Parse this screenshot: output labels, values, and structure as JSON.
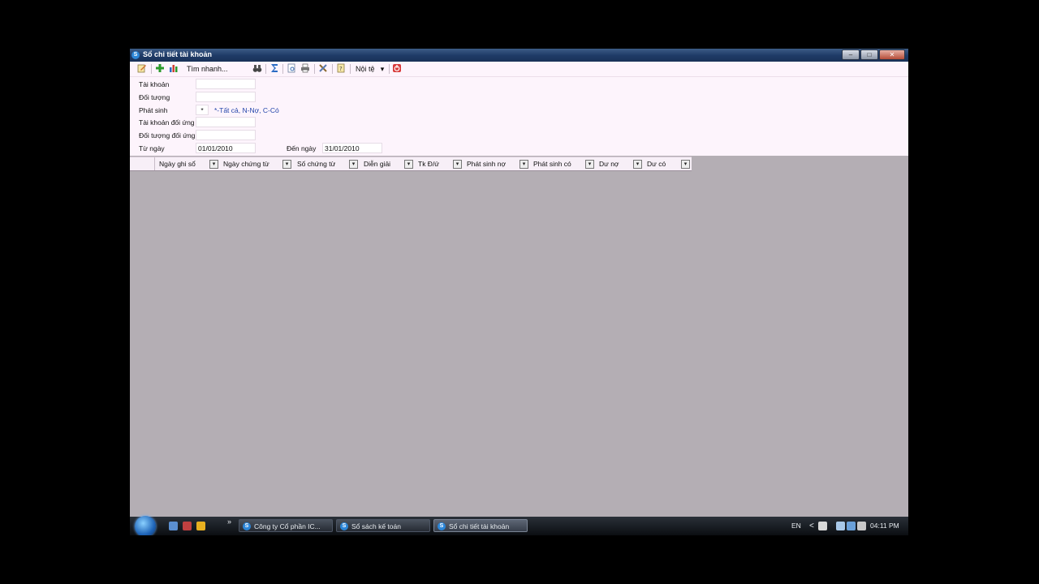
{
  "window": {
    "title": "Sổ chi tiết tài khoản",
    "app_icon_letter": "S",
    "controls": {
      "minimize": "–",
      "maximize": "□",
      "close": "✕"
    }
  },
  "toolbar": {
    "quick_search_label": "Tìm nhanh...",
    "currency_label": "Nội tệ",
    "currency_dropdown_glyph": "▾"
  },
  "filters": {
    "account_label": "Tài khoản",
    "account_value": "",
    "object_label": "Đối tượng",
    "object_value": "",
    "transaction_label": "Phát sinh",
    "transaction_value": "*",
    "transaction_hint": "*-Tất cả, N-Nợ, C-Có",
    "contra_account_label": "Tài khoản đối ứng",
    "contra_account_value": "",
    "contra_object_label": "Đối tượng đối ứng",
    "contra_object_value": "",
    "from_date_label": "Từ ngày",
    "from_date_value": "01/01/2010",
    "to_date_label": "Đến ngày",
    "to_date_value": "31/01/2010"
  },
  "grid": {
    "columns": [
      "Ngày ghi sổ",
      "Ngày chứng từ",
      "Số chứng từ",
      "Diễn giải",
      "Tk Đ/ứ",
      "Phát sinh nợ",
      "Phát sinh có",
      "Dư nợ",
      "Dư có"
    ],
    "dropdown_glyph": "▾"
  },
  "taskbar": {
    "tasks": [
      "Công ty Cổ phần IC...",
      "Sổ sách kế toán",
      "Sổ chi tiết tài khoản"
    ],
    "language": "EN",
    "clock": "04:11 PM",
    "overflow_glyph": "»",
    "tray_arrow": "<"
  }
}
